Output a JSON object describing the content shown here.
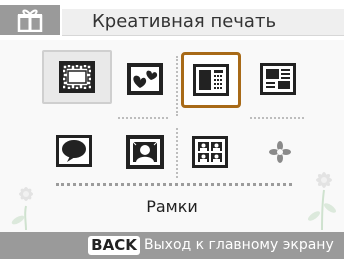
{
  "header": {
    "title": "Креативная печать",
    "icon": "gift-icon"
  },
  "menu": {
    "rows": [
      [
        {
          "name": "stamp-frame-icon"
        },
        {
          "name": "hearts-frame-icon"
        },
        {
          "name": "calendar-layout-icon"
        },
        {
          "name": "newspaper-layout-icon"
        }
      ],
      [
        {
          "name": "speech-bubble-icon"
        },
        {
          "name": "portrait-frame-icon"
        },
        {
          "name": "multi-photo-icon"
        },
        {
          "name": "sparkle-icon"
        }
      ]
    ],
    "selected_label": "Рамки"
  },
  "footer": {
    "back_key": "BACK",
    "hint": "Выход к главному экрану"
  },
  "colors": {
    "cursor": "#a86a18",
    "header_gray": "#9a9a9a",
    "footer_gray": "#9a9a9a"
  }
}
